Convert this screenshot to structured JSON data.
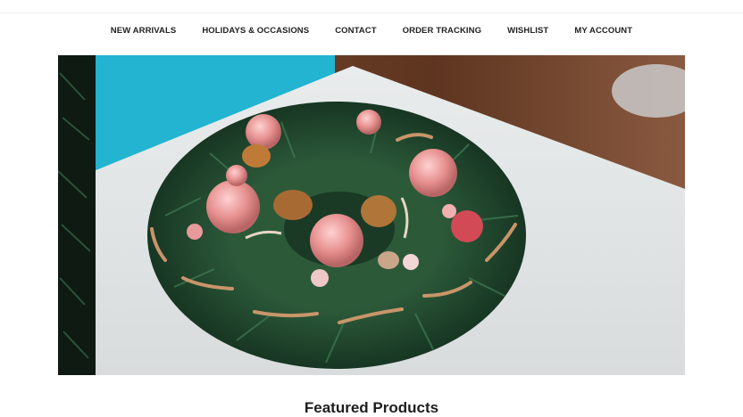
{
  "nav": {
    "items": [
      {
        "label": "NEW ARRIVALS"
      },
      {
        "label": "HOLIDAYS & OCCASIONS"
      },
      {
        "label": "CONTACT"
      },
      {
        "label": "ORDER TRACKING"
      },
      {
        "label": "WISHLIST"
      },
      {
        "label": "MY ACCOUNT"
      }
    ]
  },
  "hero": {
    "image": "christmas-wreath-photo"
  },
  "featured": {
    "title": "Featured Products"
  },
  "colors": {
    "text": "#222222",
    "wreath_green": "#1f4a2e",
    "ornament_pink": "#e79a9a",
    "table_white": "#e3e6e6",
    "wood": "#6b3e26",
    "teal": "#1fb3cf"
  }
}
